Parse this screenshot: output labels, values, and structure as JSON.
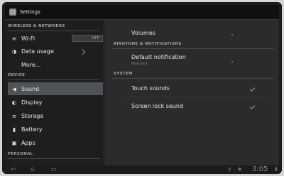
{
  "app": {
    "title": "Settings"
  },
  "sidebar": {
    "sections": [
      {
        "header": "WIRELESS & NETWORKS"
      },
      {
        "header": "DEVICE"
      },
      {
        "header": "PERSONAL"
      }
    ],
    "items": [
      {
        "label": "Wi-Fi",
        "icon": "wifi-icon",
        "glyph": "≋",
        "toggle": "OFF"
      },
      {
        "label": "Data usage",
        "icon": "data-usage-icon",
        "glyph": "◑"
      },
      {
        "label": "More..."
      },
      {
        "label": "Sound",
        "icon": "speaker-icon",
        "glyph": "◀",
        "selected": true
      },
      {
        "label": "Display",
        "icon": "display-icon",
        "glyph": "◐"
      },
      {
        "label": "Storage",
        "icon": "storage-icon",
        "glyph": "≡"
      },
      {
        "label": "Battery",
        "icon": "battery-icon",
        "glyph": "▮"
      },
      {
        "label": "Apps",
        "icon": "apps-icon",
        "glyph": "▣"
      }
    ]
  },
  "detail": {
    "volumes_label": "Volumes",
    "ringtone_header": "RINGTONE & NOTIFICATIONS",
    "default_notification": {
      "title": "Default notification",
      "summary": "Pixie Dust"
    },
    "system_header": "SYSTEM",
    "touch_sounds": {
      "label": "Touch sounds",
      "checked": true
    },
    "screen_lock_sound": {
      "label": "Screen lock sound",
      "checked": true
    }
  },
  "system_bar": {
    "time": "3:05"
  },
  "colors": {
    "selected_bg": "#4f5256",
    "header_text": "#9aa6ad"
  }
}
